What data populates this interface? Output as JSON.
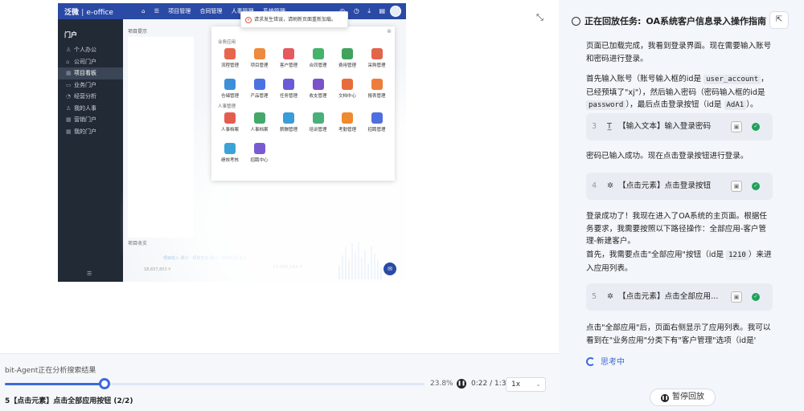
{
  "oa": {
    "brand_name": "泛微",
    "brand_sub": "e-office",
    "top_nav": [
      "项目管理",
      "合同管理",
      "人事管理",
      "系统管理"
    ],
    "sidebar_title": "门户",
    "sidebar_items": [
      "个人办公",
      "公司门户",
      "项目看板",
      "业务门户",
      "经营分析",
      "我的人事",
      "营销门户",
      "我的门户"
    ],
    "section_project": "项目提示",
    "section_stats": "项目收支",
    "toast": "请求发生错误，请刷新页面重新加载。",
    "apps_group_business": "业务应用",
    "apps_group_hr": "人事管理",
    "apps_business": [
      {
        "label": "流程管理",
        "color": "#e8664d"
      },
      {
        "label": "项目管理",
        "color": "#ee8a3d"
      },
      {
        "label": "客户管理",
        "color": "#e6595e"
      },
      {
        "label": "合同管理",
        "color": "#45b36b"
      },
      {
        "label": "费用管理",
        "color": "#3fa35e"
      },
      {
        "label": "采购管理",
        "color": "#e0654b"
      },
      {
        "label": "仓储管理",
        "color": "#3e8fd9"
      },
      {
        "label": "产品管理",
        "color": "#4b72e0"
      },
      {
        "label": "任务管理",
        "color": "#6a5ad8"
      },
      {
        "label": "收支管理",
        "color": "#7a52c9"
      },
      {
        "label": "文档中心",
        "color": "#e86c3a"
      },
      {
        "label": "报表管理",
        "color": "#ee7d3b"
      }
    ],
    "apps_hr": [
      {
        "label": "人事档案",
        "color": "#e45c4f"
      },
      {
        "label": "人事档案",
        "color": "#43a86a"
      },
      {
        "label": "薪酬管理",
        "color": "#3a9cd8"
      },
      {
        "label": "培训管理",
        "color": "#49b07a"
      },
      {
        "label": "考勤管理",
        "color": "#ef8a2f"
      },
      {
        "label": "招聘管理",
        "color": "#4f6fe0"
      },
      {
        "label": "绩效考核",
        "color": "#3aa4d8"
      },
      {
        "label": "招聘中心",
        "color": "#7a5ad2"
      }
    ],
    "stats_legend": "项目收入·累计 · 项目支出·累计 · 项目利润·累计",
    "stats_big": "17,093,593 ¥",
    "stats_small": "18,837,803 ¥",
    "bar_heights": [
      0.35,
      0.6,
      0.8,
      0.5,
      0.9,
      0.7,
      0.95,
      0.55,
      0.75,
      0.4,
      0.85,
      0.65,
      0.5,
      0.3
    ]
  },
  "player": {
    "status_text": "bit-Agent正在分析搜索结果",
    "progress": 0.238,
    "progress_label": "23.8%",
    "time": "0:22 / 1:34",
    "speed": "1x",
    "current_step": "5【点击元素】点击全部应用按钮 (2/2)"
  },
  "panel": {
    "replay_label": "正在回放任务:",
    "task_title": "OA系统客户信息录入操作指南",
    "para1": "页面已加载完成，我看到登录界面。现在需要输入账号和密码进行登录。",
    "para2_a": "首先输入账号（账号输入框的id是 ",
    "para2_code1": "user_account",
    "para2_b": "，已经预填了\"xj\"），然后输入密码（密码输入框的id是 ",
    "para2_code2": "password",
    "para2_c": "），最后点击登录按钮（id是 ",
    "para2_code3": "AdA1",
    "para2_d": "）。",
    "step3_num": "3",
    "step3_text": "【输入文本】输入登录密码",
    "para3": "密码已输入成功。现在点击登录按钮进行登录。",
    "step4_num": "4",
    "step4_text": "【点击元素】点击登录按钮",
    "para4": "登录成功了！我现在进入了OA系统的主页面。根据任务要求，我需要按照以下路径操作：全部应用-客户管理-新建客户。",
    "para5_a": "首先，我需要点击\"全部应用\"按钮（id是 ",
    "para5_code": "1210",
    "para5_b": "）来进入应用列表。",
    "step5_num": "5",
    "step5_text": "【点击元素】点击全部应用...",
    "para6": "点击\"全部应用\"后，页面右侧显示了应用列表。我可以看到在\"业务应用\"分类下有\"客户管理\"选项（id是'",
    "thinking": "思考中",
    "pause": "暂停回放"
  }
}
